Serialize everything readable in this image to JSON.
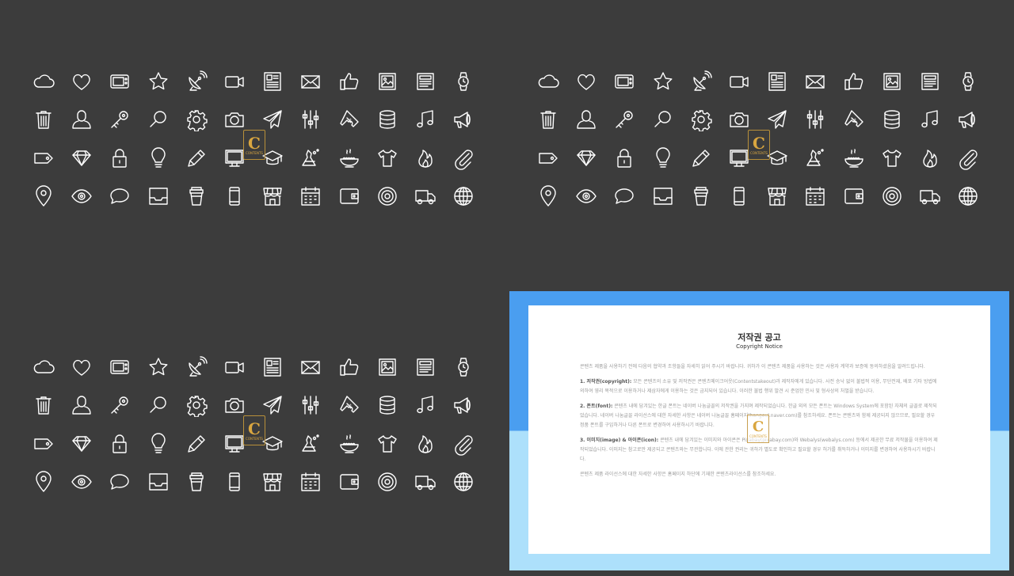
{
  "icon_rows": [
    [
      "cloud-icon",
      "heart-icon",
      "tv-icon",
      "star-icon",
      "satellite-dish-icon",
      "video-camera-icon",
      "newspaper-icon",
      "mail-icon",
      "thumbs-up-icon",
      "image-icon",
      "document-icon",
      "watch-icon"
    ],
    [
      "trash-icon",
      "user-icon",
      "key-icon",
      "magnifier-icon",
      "gear-icon",
      "camera-icon",
      "paper-plane-icon",
      "sliders-icon",
      "ticket-icon",
      "database-icon",
      "music-note-icon",
      "megaphone-icon"
    ],
    [
      "tag-icon",
      "diamond-icon",
      "lock-icon",
      "lightbulb-icon",
      "pencil-icon",
      "monitor-icon",
      "graduation-cap-icon",
      "flask-icon",
      "food-bowl-icon",
      "tshirt-icon",
      "flame-icon",
      "paperclip-icon"
    ],
    [
      "map-pin-icon",
      "eye-icon",
      "speech-bubble-icon",
      "inbox-icon",
      "coffee-cup-icon",
      "smartphone-icon",
      "store-icon",
      "calendar-icon",
      "wallet-icon",
      "disc-icon",
      "truck-icon",
      "globe-icon"
    ]
  ],
  "icon_color": "#ffffff",
  "background_color": "#3c3c3c",
  "watermark": {
    "letter": "C",
    "text": "CONTENTS"
  },
  "notice": {
    "title": "저작권 공고",
    "subtitle": "Copyright Notice",
    "intro": "콘텐츠 제품을 사용하기 전에 다음의 협약과 조항들을 자세히 읽어 주시기 바랍니다. 귀하가 이 콘텐츠 제품을 사용하는 것은 사용자 계약과 보증에 동의하셨음을 알려드립니다.",
    "sec1_head": "1. 저작권(copyright):",
    "sec1_body": "모든 콘텐츠의 소유 및 저작권은 콘텐츠메이크어웃(Contentstakeout)과 제작자에게 있습니다. 사전 승낙 없이 불법적 이용, 무단전재, 배포 기타 방법에 의하여 영리 목적으로 이용하거나 제삼자에게 이용하는 것은 금지되어 있습니다. 이러한 불법 행위 발견 시 준엄한 민사 및 형사상의 처벌을 받습니다.",
    "sec2_head": "2. 폰트(font):",
    "sec2_body": "콘텐츠 내에 담겨있는 한글 폰트는 네이버 나눔글꼴의 저작권을 가지며 제작되었습니다. 한글 외의 모든 폰트는 Windows System에 포함된 자체의 글꼴로 제작되었습니다. 네이버 나눔글꼴 라이선스에 대한 자세한 사항은 네이버 나눔글꼴 홈페이지(hangeul.naver.com)를 참조하세요. 폰트는 콘텐츠와 함께 제공되지 않으므로, 필요할 경우 정품 폰트를 구입하거나 다른 폰트로 변경하여 사용하시기 바랍니다.",
    "sec3_head": "3. 이미지(image) & 아이콘(icon):",
    "sec3_body": "콘텐츠 내에 담겨있는 이미지와 아이콘은 Pixabay(pixabay.com)와 Webalys(webalys.com) 등에서 제공한 무료 저작물을 이용하여 제작되었습니다. 이미지는 참고로만 제공되고 콘텐츠와는 무관합니다. 이에 관한 권리는 귀하가 별도로 확인하고 필요할 경우 허가를 취득하거나 이미지를 변경하여 사용하시기 바랍니다.",
    "outro": "콘텐츠 제품 라이선스에 대한 자세한 사항은 홈페이지 하단에 기재한 콘텐츠라이선스를 참조하세요."
  }
}
